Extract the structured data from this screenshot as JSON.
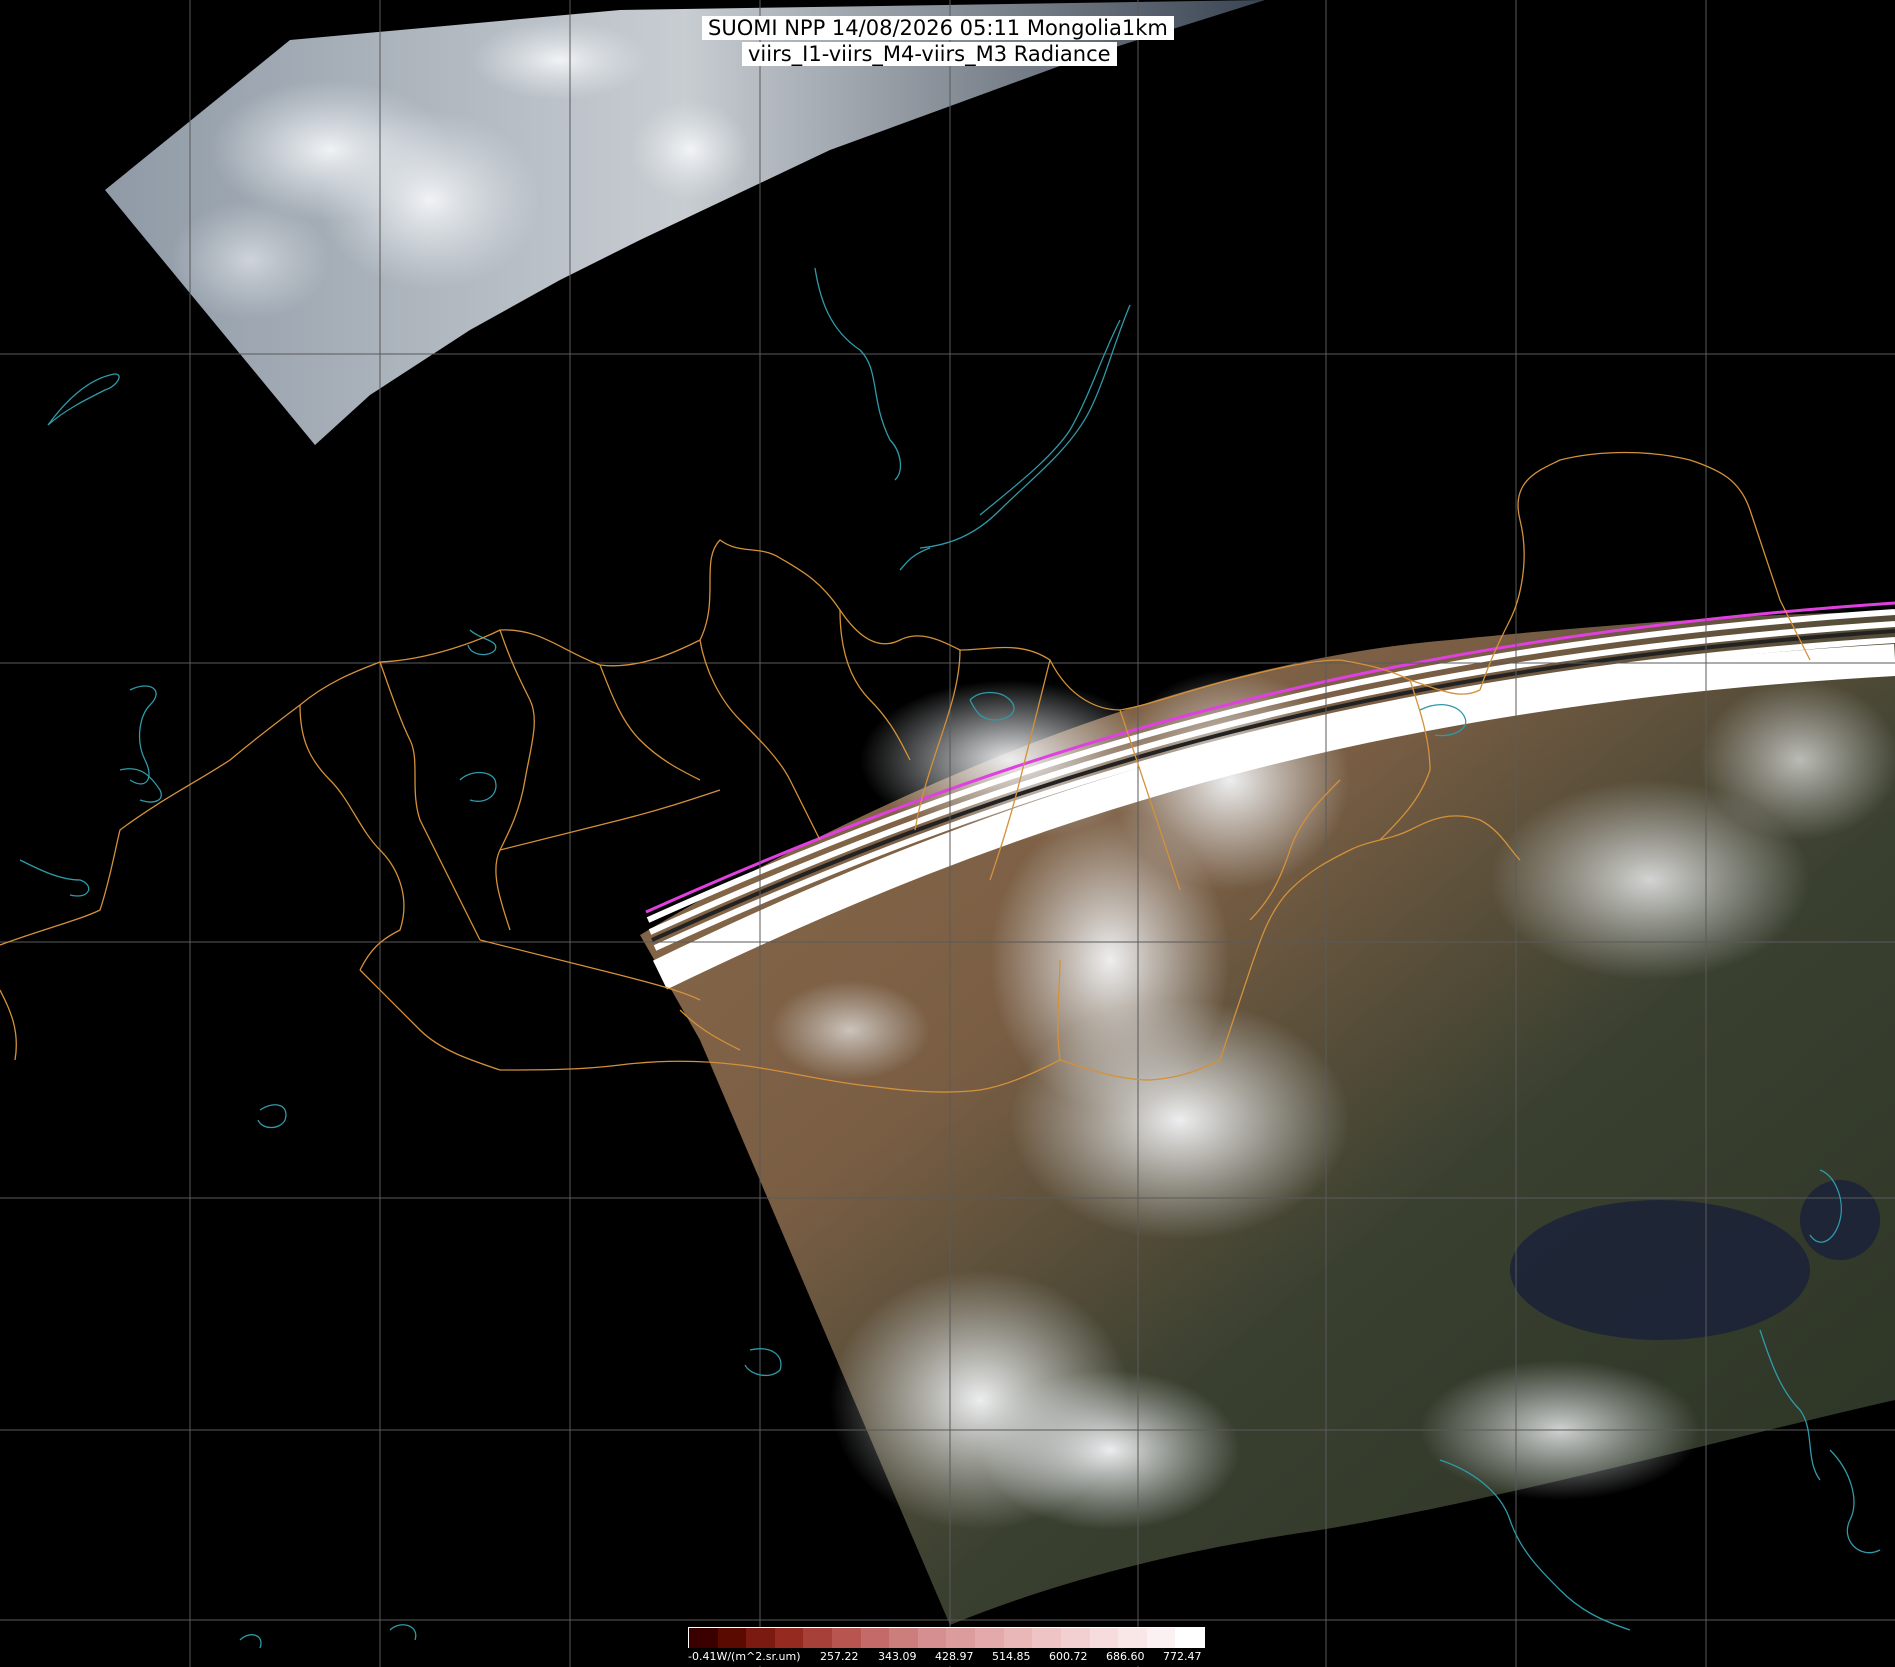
{
  "header": {
    "title_line1": "SUOMI NPP 14/08/2026 05:11 Mongolia1km",
    "title_line2": "viirs_I1-viirs_M4-viirs_M3 Radiance"
  },
  "colors": {
    "background": "#000000",
    "graticule": "#5a5a5a",
    "border": "#d4913a",
    "coast": "#2f9aa8",
    "swath_cloud": "#e8ecef",
    "swath_desert": "#8a6a4a",
    "swath_forest": "#2f3a26",
    "artifact_magenta": "#e040e0"
  },
  "colorbar": {
    "unit_label": "-0.41W/(m^2.sr.um)",
    "tick_labels": [
      "257.22",
      "343.09",
      "428.97",
      "514.85",
      "600.72",
      "686.60",
      "772.47"
    ],
    "swatches": [
      "#3a0000",
      "#5a0a00",
      "#7a1a10",
      "#952a20",
      "#a8403a",
      "#b85550",
      "#c46a68",
      "#cc7e7c",
      "#d68f90",
      "#dc9c9d",
      "#e4aaab",
      "#e9b7b8",
      "#eec4c5",
      "#f2d0d1",
      "#f6dcdd",
      "#f9e7e8",
      "#fcf1f2",
      "#ffffff"
    ]
  }
}
